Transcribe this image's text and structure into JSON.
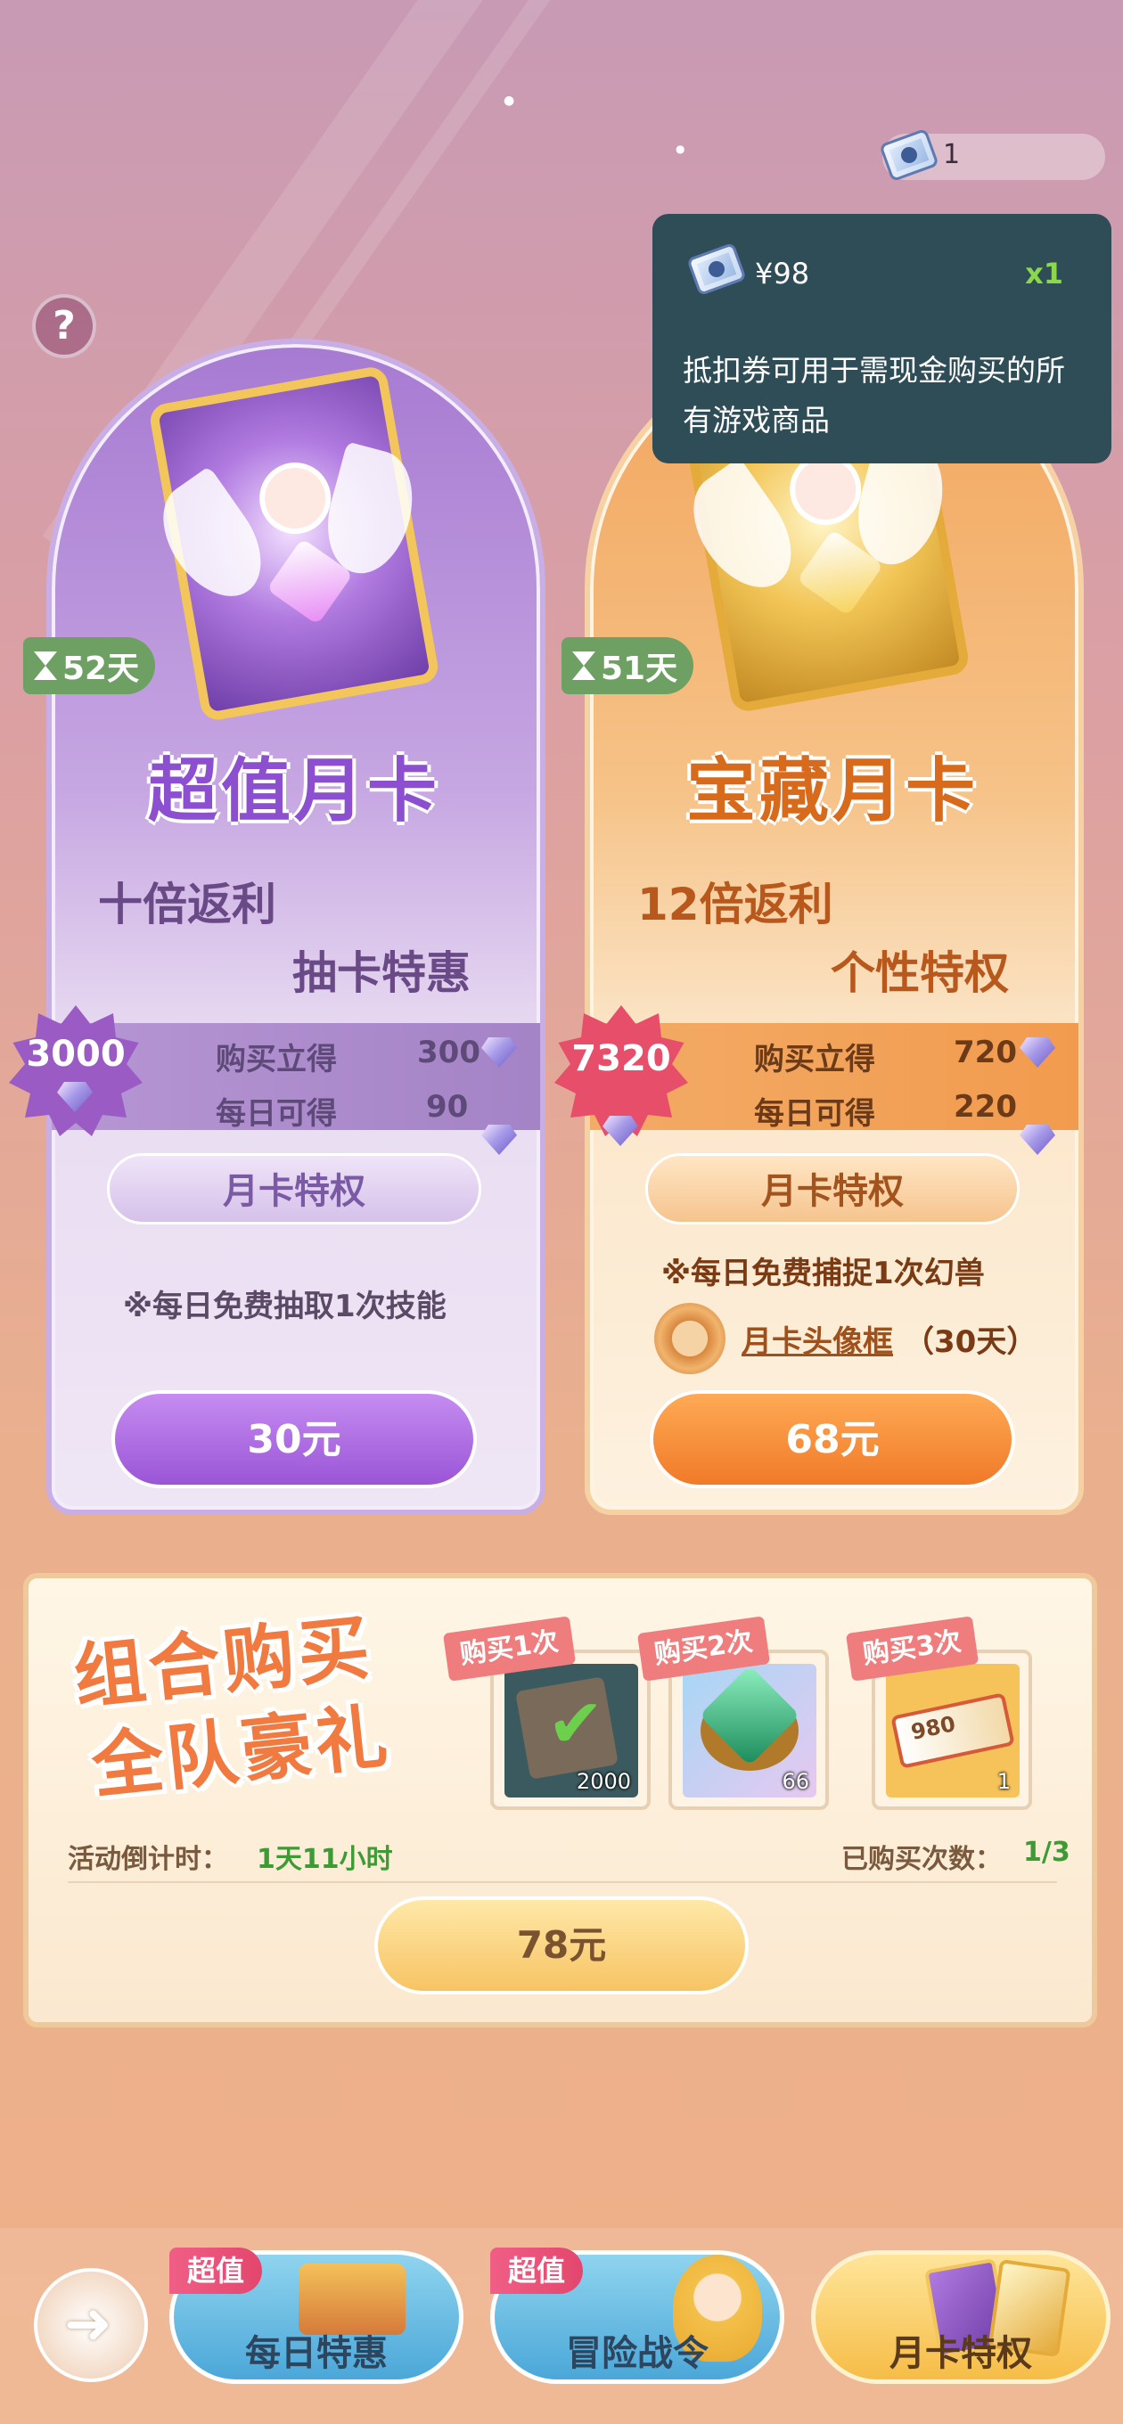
{
  "currency": {
    "icon": "voucher-icon",
    "amount": "1"
  },
  "tooltip": {
    "icon": "voucher-icon",
    "price": "¥98",
    "quantity": "x1",
    "description": "抵扣券可用于需现金购买的所有游戏商品"
  },
  "help": {
    "label": "?"
  },
  "cards": [
    {
      "days_left": "52天",
      "title": "超值月卡",
      "line1": "十倍返利",
      "line2": "抽卡特惠",
      "total": "3000",
      "instant_label": "购买立得",
      "instant_value": "300",
      "daily_label": "每日可得",
      "daily_value": "90",
      "privilege_label": "月卡特权",
      "features": [
        "※每日免费抽取1次技能"
      ],
      "price": "30元"
    },
    {
      "days_left": "51天",
      "title": "宝藏月卡",
      "line1": "12倍返利",
      "line2": "个性特权",
      "total": "7320",
      "instant_label": "购买立得",
      "instant_value": "720",
      "daily_label": "每日可得",
      "daily_value": "220",
      "privilege_label": "月卡特权",
      "features": [
        "※每日免费捕捉1次幻兽"
      ],
      "frame_label": "月卡头像框",
      "frame_duration": "（30天）",
      "price": "68元"
    }
  ],
  "bundle": {
    "title_line1": "组合购买",
    "title_line2": "全队豪礼",
    "slots": [
      {
        "tag": "购买1次",
        "count": "2000",
        "icon": "skill-book-icon"
      },
      {
        "tag": "购买2次",
        "count": "66",
        "icon": "emerald-ring-icon"
      },
      {
        "tag": "购买3次",
        "count": "1",
        "icon": "voucher-980-icon",
        "voucher_value": "980"
      }
    ],
    "countdown_label": "活动倒计时：",
    "countdown_value": "1天11小时",
    "purchased_label": "已购买次数：",
    "purchased_value": "1/3",
    "price": "78元"
  },
  "nav": {
    "back_icon": "back-arrow-icon",
    "tabs": [
      {
        "label": "每日特惠",
        "tag": "超值"
      },
      {
        "label": "冒险战令",
        "tag": "超值"
      },
      {
        "label": "月卡特权",
        "tag": ""
      }
    ]
  },
  "colors": {
    "purple_accent": "#9a55d6",
    "orange_accent": "#f07a28",
    "badge_green": "#6ea063",
    "tooltip_bg": "#2f4d57"
  }
}
